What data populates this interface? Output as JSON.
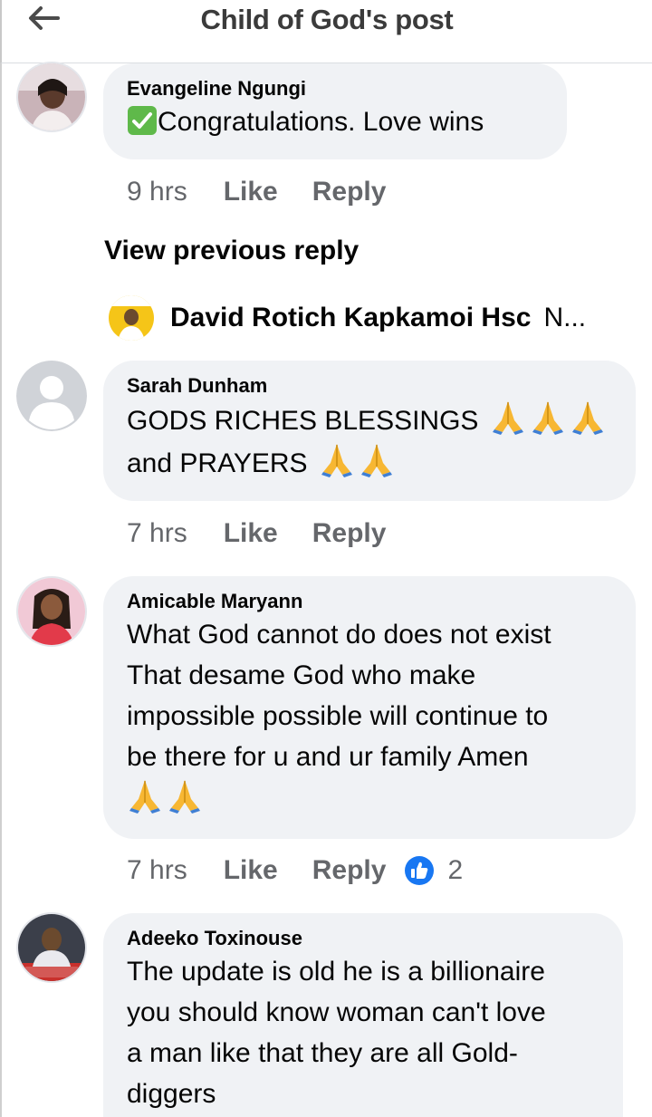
{
  "header": {
    "title": "Child of God's post",
    "back_icon": "arrow-left-icon"
  },
  "comments": [
    {
      "author": "Evangeline Ngungi",
      "text_lines": [
        "Congratulations.  Love wins"
      ],
      "prefix_icon": "check-mark-button-icon",
      "time": "9 hrs",
      "like": "Like",
      "reply": "Reply"
    },
    {
      "author": "Sarah Dunham",
      "text_lines": [
        "GODS RICHES BLESSINGS",
        "and PRAYERS"
      ],
      "time": "7 hrs",
      "like": "Like",
      "reply": "Reply"
    },
    {
      "author": "Amicable Maryann",
      "text_lines": [
        "What God cannot do does not exist",
        "That desame God who make",
        "impossible possible will continue to",
        "be there for u and ur family Amen"
      ],
      "time": "7 hrs",
      "like": "Like",
      "reply": "Reply",
      "reaction_count": "2",
      "reaction_icon": "like-reaction-icon"
    },
    {
      "author": "Adeeko Toxinouse",
      "text_lines": [
        "The update is old he is a billionaire",
        "you should know woman can't love",
        "a man like that they are all Gold-",
        "diggers"
      ]
    }
  ],
  "thread": {
    "view_previous": "View previous reply",
    "nested_author": "David Rotich Kapkamoi Hsc",
    "nested_snippet": "N..."
  },
  "colors": {
    "bubble": "#f0f2f5",
    "meta": "#65676b",
    "like_blue": "#1877f2",
    "text": "#050505"
  }
}
